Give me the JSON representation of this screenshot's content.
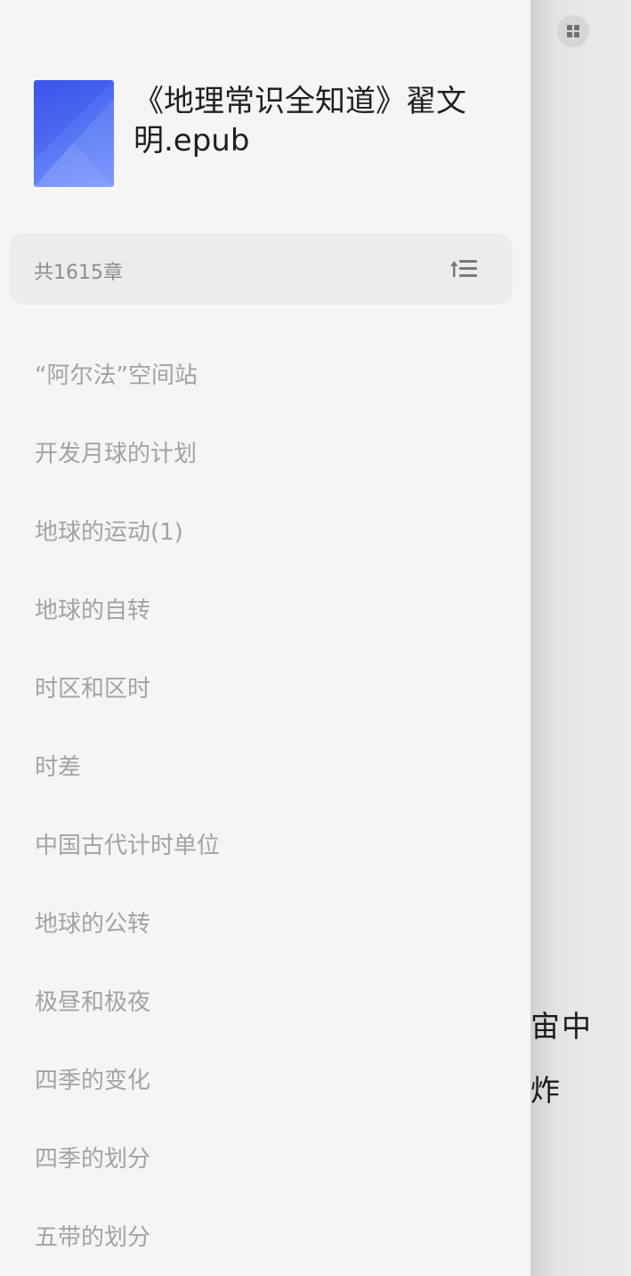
{
  "reader": {
    "visible_lines": [
      "宙中",
      "炸"
    ]
  },
  "book": {
    "title": "《地理常识全知道》翟文明.epub"
  },
  "toc": {
    "chapter_count": "共1615章",
    "items": [
      "“阿尔法”空间站",
      "开发月球的计划",
      "地球的运动(1)",
      "地球的自转",
      "时区和区时",
      "时差",
      "中国古代计时单位",
      "地球的公转",
      "极昼和极夜",
      "四季的变化",
      "四季的划分",
      "五带的划分"
    ]
  },
  "colors": {
    "drawer_bg": "#f5f5f5",
    "bar_bg": "#ececec",
    "toc_text": "#a3a3a3",
    "cover_blue": "#4e6cf3"
  },
  "icons": {
    "menu": "grid-menu-icon",
    "sort": "sort-list-icon"
  }
}
